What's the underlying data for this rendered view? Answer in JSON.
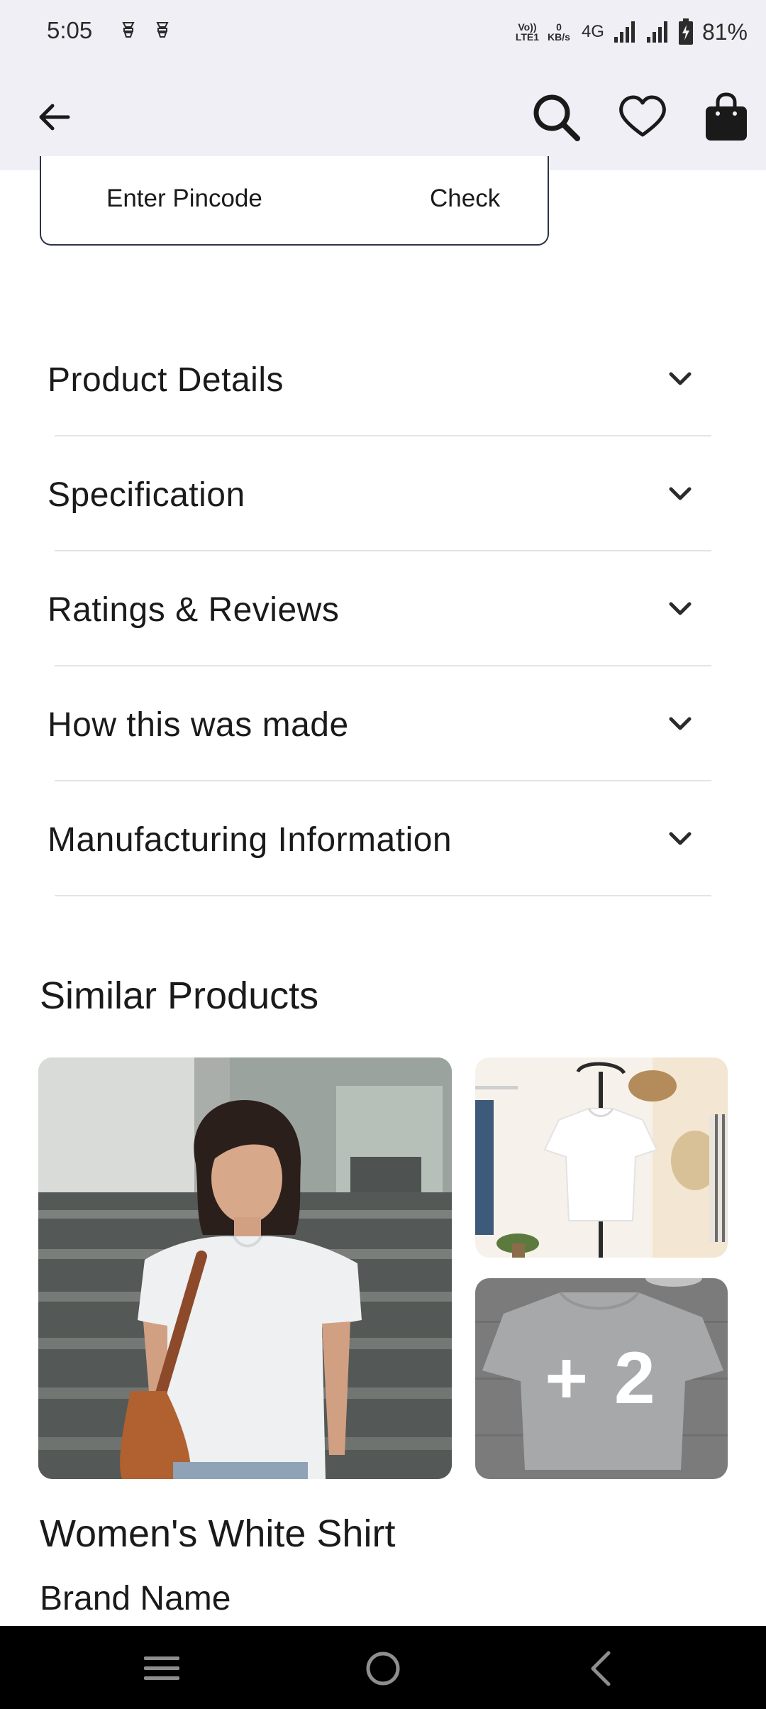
{
  "status_bar": {
    "time": "5:05",
    "volte_top": "Vo))",
    "volte_bottom": "LTE1",
    "speed_value": "0",
    "speed_unit": "KB/s",
    "network": "4G",
    "battery": "81%"
  },
  "app_bar": {
    "icons": [
      "back-arrow-icon",
      "search-icon",
      "heart-icon",
      "shopping-bag-icon"
    ]
  },
  "pincode": {
    "placeholder": "Enter Pincode",
    "value": "",
    "check_label": "Check"
  },
  "accordion": {
    "items": [
      {
        "label": "Product Details"
      },
      {
        "label": "Specification"
      },
      {
        "label": "Ratings & Reviews"
      },
      {
        "label": "How this was made"
      },
      {
        "label": "Manufacturing Information"
      }
    ]
  },
  "similar": {
    "title": "Similar Products",
    "more_count": "+ 2",
    "product_title": "Women's White Shirt",
    "brand": "Brand Name"
  },
  "colors": {
    "app_bar_bg": "#f1eff6",
    "text_primary": "#1a1a1a",
    "divider": "#e4e4e4",
    "pincode_border": "#2c3346",
    "nav_bar_bg": "#000000"
  }
}
